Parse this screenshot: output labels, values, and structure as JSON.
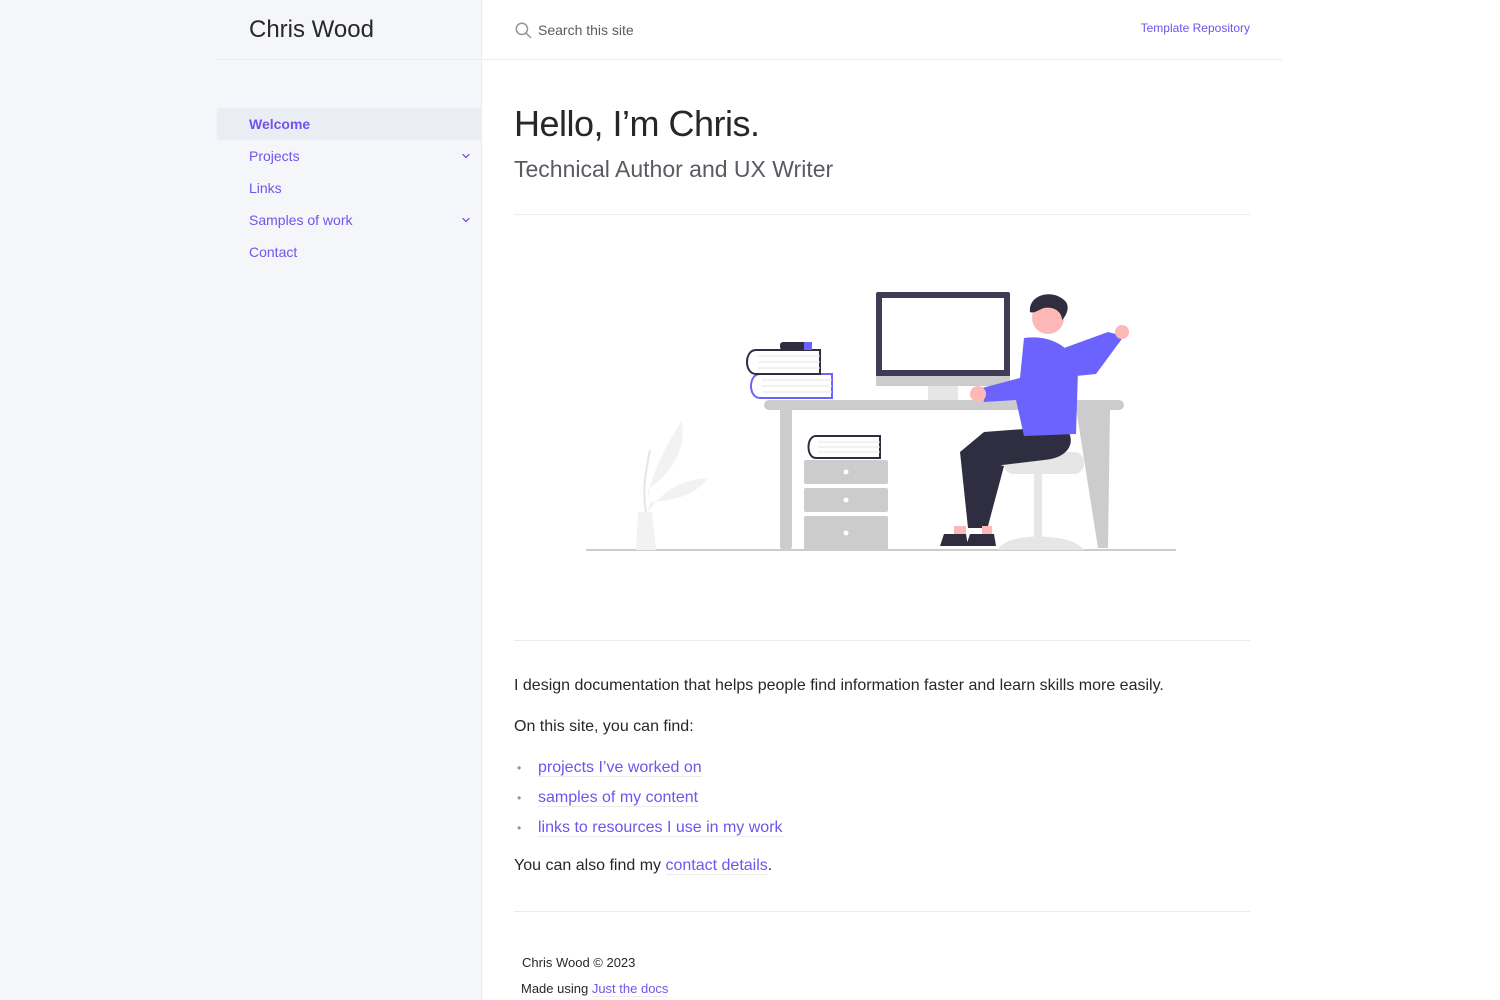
{
  "site": {
    "title": "Chris Wood"
  },
  "header": {
    "search_placeholder": "Search this site",
    "aux_link": "Template Repository"
  },
  "nav": {
    "items": [
      {
        "label": "Welcome",
        "active": true
      },
      {
        "label": "Projects",
        "expandable": true
      },
      {
        "label": "Links"
      },
      {
        "label": "Samples of work",
        "expandable": true
      },
      {
        "label": "Contact"
      }
    ]
  },
  "main": {
    "title": "Hello, I’m Chris.",
    "subtitle": "Technical Author and UX Writer",
    "intro": "I design documentation that helps people find information faster and learn skills more easily.",
    "find_lead": "On this site, you can find:",
    "find_links": [
      "projects I’ve worked on",
      "samples of my content",
      "links to resources I use in my work"
    ],
    "contact_before": "You can also find my ",
    "contact_link": "contact details",
    "contact_after": "."
  },
  "footer": {
    "copyright": "Chris Wood © 2023",
    "made_using": "Made using ",
    "made_link": "Just the docs"
  },
  "colors": {
    "accent": "#7253ed",
    "text_dark": "#27262b",
    "sidebar_bg": "#f5f6fa",
    "illustration_purple": "#6c63ff",
    "illustration_dark": "#2f2e41",
    "illustration_skin": "#ffb8b8"
  },
  "icons": [
    "search-icon",
    "chevron-down-icon"
  ]
}
